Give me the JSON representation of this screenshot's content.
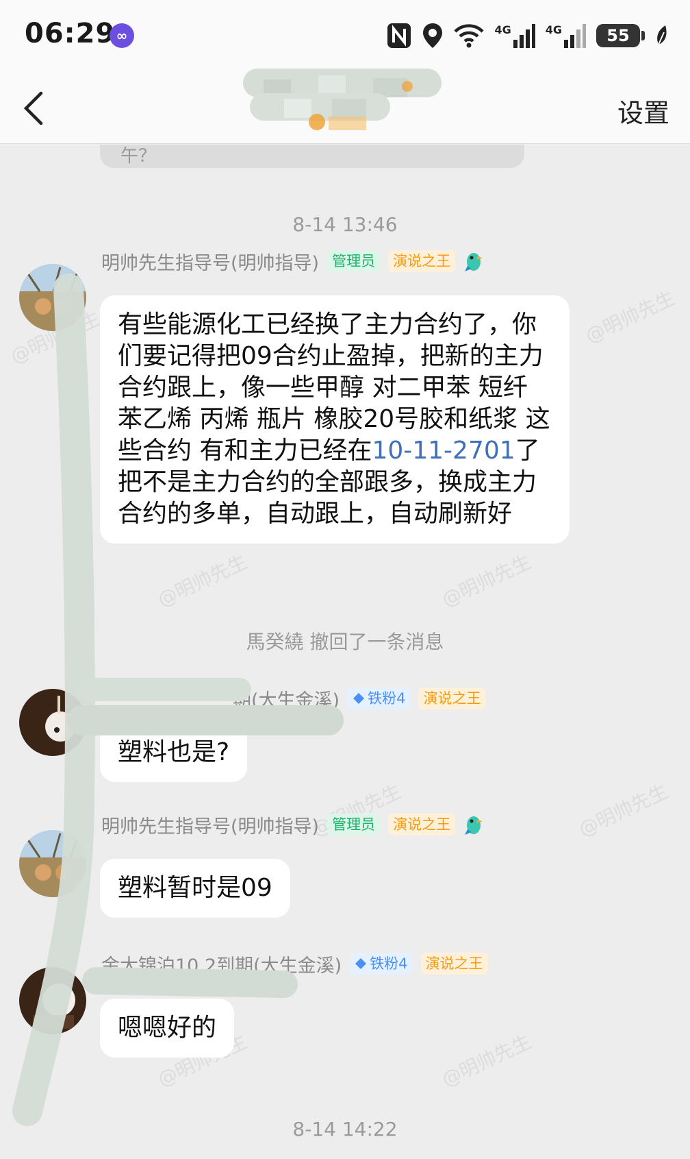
{
  "status_bar": {
    "time": "06:29",
    "network_1": "4G",
    "network_2": "4G",
    "battery": "55"
  },
  "header": {
    "settings_label": "设置"
  },
  "chat": {
    "prev_fragment": "午？",
    "timestamp_1": "8-14 13:46",
    "timestamp_2": "8-14 14:22",
    "recall_notice": "馬癸繞 撤回了一条消息",
    "watermark": "@明帅先生",
    "messages": [
      {
        "sender": "明帅先生指导号(明帅指导)",
        "badges": [
          "管理员",
          "演说之王"
        ],
        "text_before_link": "有些能源化工已经换了主力合约了，你们要记得把09合约止盈掉，把新的主力合约跟上，像一些甲醇 对二甲苯 短纤 苯乙烯 丙烯 瓶片 橡胶20号胶和纸浆 这些合约 有和主力已经在",
        "link": "10-11-2701",
        "text_after_link": "了 把不是主力合约的全部跟多，换成主力合约的多单，自动跟上，自动刷新好"
      },
      {
        "sender": "期(大生金溪)",
        "badges": [
          "铁粉4",
          "演说之王"
        ],
        "text": "塑料也是?"
      },
      {
        "sender": "明帅先生指导号(明帅指导)",
        "badges": [
          "管理员",
          "演说之王"
        ],
        "text": "塑料暂时是09"
      },
      {
        "sender": "金大锦泊10.2到期(大生金溪)",
        "badges": [
          "铁粉4",
          "演说之王"
        ],
        "text": "嗯嗯好的"
      }
    ]
  },
  "colors": {
    "background": "#ededed",
    "bubble": "#ffffff",
    "admin_badge": "#1db36b",
    "speech_badge": "#f39c12",
    "fan_badge": "#4b8ff5",
    "link": "#3f6fb8"
  }
}
